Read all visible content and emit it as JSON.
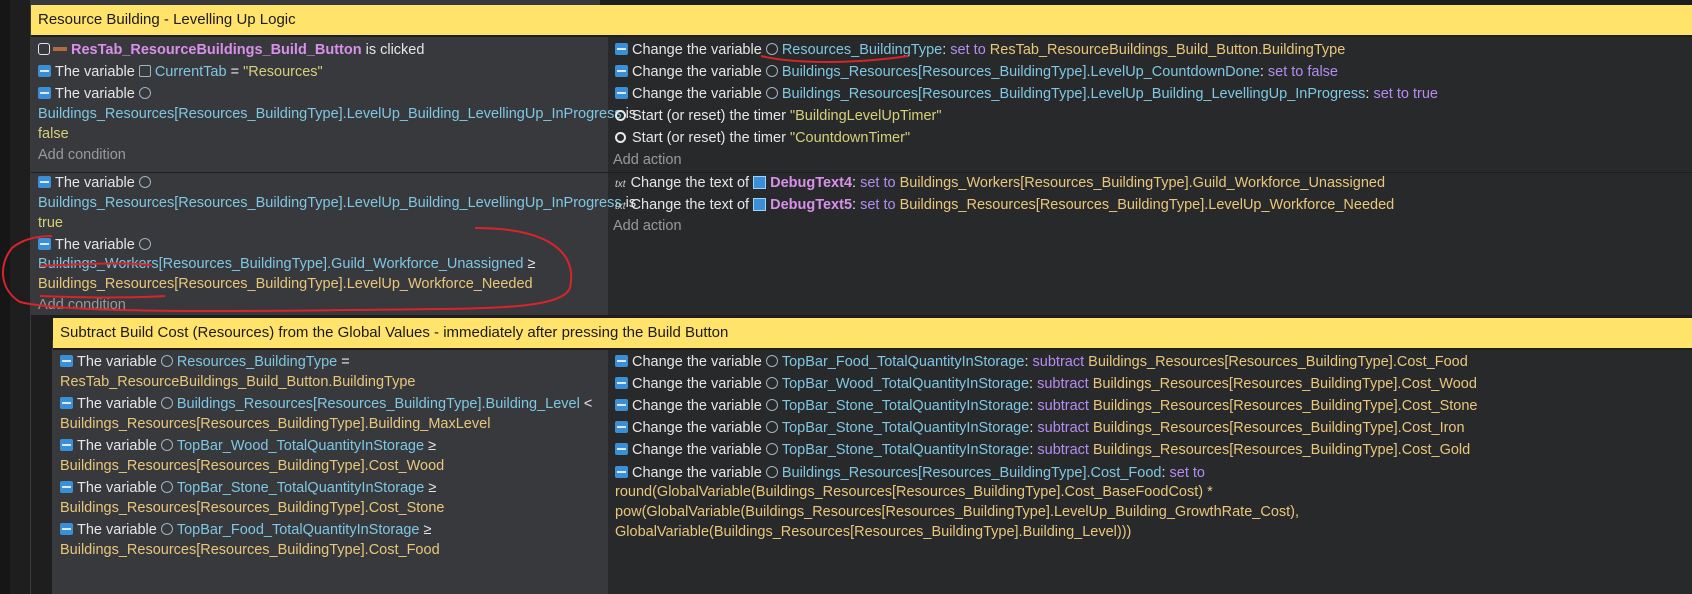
{
  "group1": {
    "title": "Resource Building - Levelling Up Logic",
    "event1": {
      "conditions": {
        "c1": {
          "object": "ResTab_ResourceBuildings_Build_Button",
          "text": "is clicked"
        },
        "c2": {
          "prefix": "The variable",
          "var": "CurrentTab",
          "op": "=",
          "value": "\"Resources\""
        },
        "c3": {
          "prefix": "The variable",
          "var": "Buildings_Resources[Resources_BuildingType].LevelUp_Building_LevellingUp_InProgress",
          "is": "is",
          "value": "false"
        },
        "add": "Add condition"
      },
      "actions": {
        "a1": {
          "prefix": "Change the variable",
          "var": "Resources_BuildingType",
          "op": "set to",
          "value": "ResTab_ResourceBuildings_Build_Button.BuildingType"
        },
        "a2": {
          "prefix": "Change the variable",
          "var": "Buildings_Resources[Resources_BuildingType].LevelUp_CountdownDone",
          "op": "set to false"
        },
        "a3": {
          "prefix": "Change the variable",
          "var": "Buildings_Resources[Resources_BuildingType].LevelUp_Building_LevellingUp_InProgress",
          "op": "set to true"
        },
        "a4": {
          "prefix": "Start (or reset) the timer",
          "value": "\"BuildingLevelUpTimer\""
        },
        "a5": {
          "prefix": "Start (or reset) the timer",
          "value": "\"CountdownTimer\""
        },
        "add": "Add action"
      }
    },
    "event2": {
      "conditions": {
        "c1": {
          "prefix": "The variable",
          "var": "Buildings_Resources[Resources_BuildingType].LevelUp_Building_LevellingUp_InProgress",
          "is": "is",
          "value": "true"
        },
        "c2": {
          "prefix": "The variable",
          "var": "Buildings_Workers[Resources_BuildingType].Guild_Workforce_Unassigned",
          "op": "≥",
          "value": "Buildings_Resources[Resources_BuildingType].LevelUp_Workforce_Needed"
        },
        "add": "Add condition"
      },
      "actions": {
        "a1": {
          "prefix": "Change the text of",
          "object": "DebugText4",
          "op": "set to",
          "value": "Buildings_Workers[Resources_BuildingType].Guild_Workforce_Unassigned"
        },
        "a2": {
          "prefix": "Change the text of",
          "object": "DebugText5",
          "op": "set to",
          "value": "Buildings_Resources[Resources_BuildingType].LevelUp_Workforce_Needed"
        },
        "add": "Add action"
      }
    }
  },
  "group2": {
    "title": "Subtract Build Cost (Resources) from the Global Values - immediately after pressing the Build Button",
    "conditions": {
      "c1": {
        "prefix": "The variable",
        "var": "Resources_BuildingType",
        "op": "=",
        "value": "ResTab_ResourceBuildings_Build_Button.BuildingType"
      },
      "c2": {
        "prefix": "The variable",
        "var": "Buildings_Resources[Resources_BuildingType].Building_Level",
        "op": "<",
        "value": "Buildings_Resources[Resources_BuildingType].Building_MaxLevel"
      },
      "c3": {
        "prefix": "The variable",
        "var": "TopBar_Wood_TotalQuantityInStorage",
        "op": "≥",
        "value": "Buildings_Resources[Resources_BuildingType].Cost_Wood"
      },
      "c4": {
        "prefix": "The variable",
        "var": "TopBar_Stone_TotalQuantityInStorage",
        "op": "≥",
        "value": "Buildings_Resources[Resources_BuildingType].Cost_Stone"
      },
      "c5": {
        "prefix": "The variable",
        "var": "TopBar_Food_TotalQuantityInStorage",
        "op": "≥",
        "value": "Buildings_Resources[Resources_BuildingType].Cost_Food"
      }
    },
    "actions": {
      "a1": {
        "prefix": "Change the variable",
        "var": "TopBar_Food_TotalQuantityInStorage",
        "op": "subtract",
        "value": "Buildings_Resources[Resources_BuildingType].Cost_Food"
      },
      "a2": {
        "prefix": "Change the variable",
        "var": "TopBar_Wood_TotalQuantityInStorage",
        "op": "subtract",
        "value": "Buildings_Resources[Resources_BuildingType].Cost_Wood"
      },
      "a3": {
        "prefix": "Change the variable",
        "var": "TopBar_Stone_TotalQuantityInStorage",
        "op": "subtract",
        "value": "Buildings_Resources[Resources_BuildingType].Cost_Stone"
      },
      "a4": {
        "prefix": "Change the variable",
        "var": "TopBar_Stone_TotalQuantityInStorage",
        "op": "subtract",
        "value": "Buildings_Resources[Resources_BuildingType].Cost_Iron"
      },
      "a5": {
        "prefix": "Change the variable",
        "var": "TopBar_Stone_TotalQuantityInStorage",
        "op": "subtract",
        "value": "Buildings_Resources[Resources_BuildingType].Cost_Gold"
      },
      "a6": {
        "prefix": "Change the variable",
        "var": "Buildings_Resources[Resources_BuildingType].Cost_Food",
        "op": "set to",
        "expr1": "round(GlobalVariable(Buildings_Resources[Resources_BuildingType].Cost_BaseFoodCost) *",
        "expr2": "pow(GlobalVariable(Buildings_Resources[Resources_BuildingType].LevelUp_Building_GrowthRate_Cost),",
        "expr3": "GlobalVariable(Buildings_Resources[Resources_BuildingType].Building_Level)))"
      }
    }
  },
  "colors": {
    "group_header": "#ffe36b",
    "annotation": "#d8242b"
  },
  "icons": [
    "variable-icon",
    "global-variable-icon",
    "scene-variable-icon",
    "timer-icon",
    "text-icon",
    "text-object-icon",
    "mouse-icon"
  ]
}
